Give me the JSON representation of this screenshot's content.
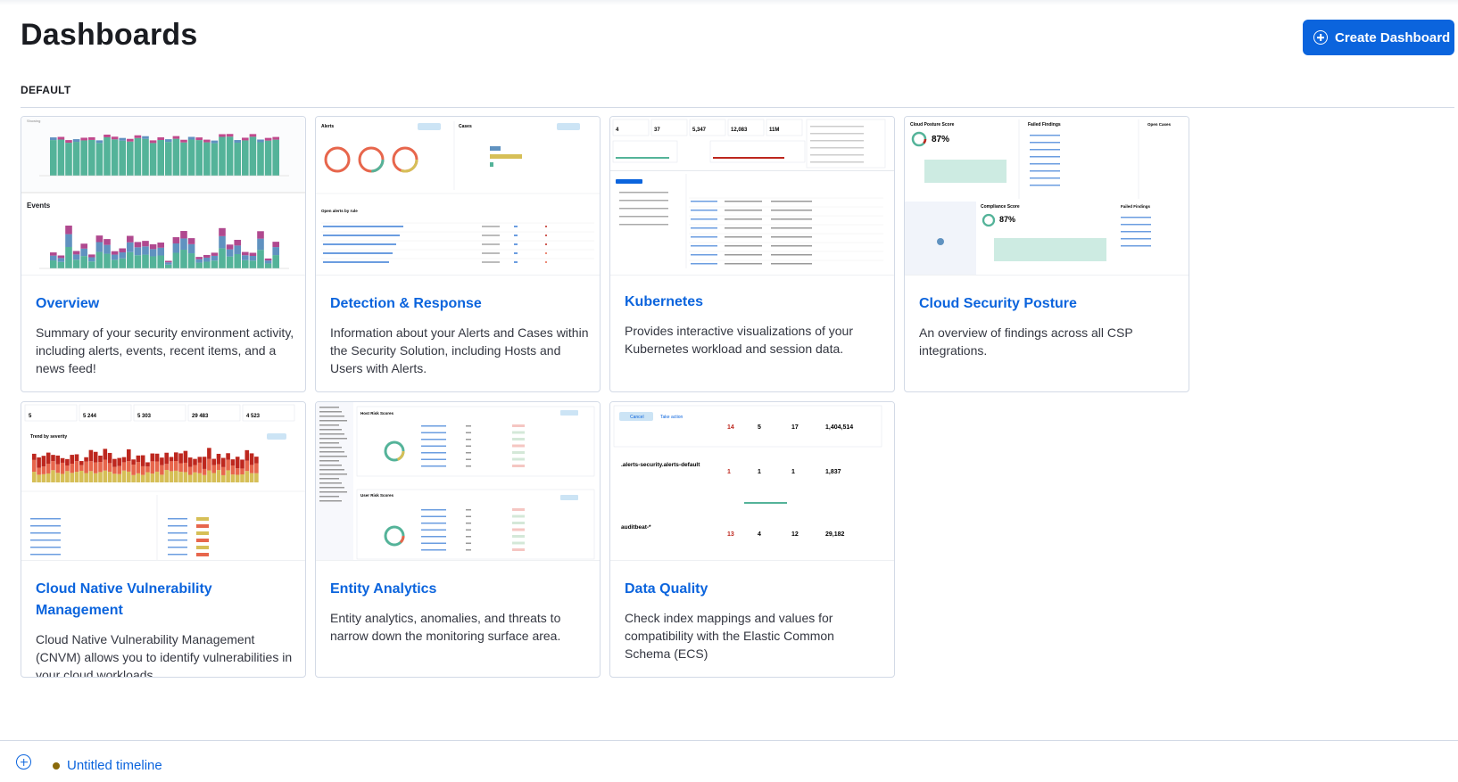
{
  "page": {
    "title": "Dashboards",
    "create_button_label": "Create Dashboard",
    "section_label": "DEFAULT"
  },
  "cards": [
    {
      "title": "Overview",
      "description": "Summary of your security environment activity, including alerts, events, recent items, and a news feed!"
    },
    {
      "title": "Detection & Response",
      "description": "Information about your Alerts and Cases within the Security Solution, including Hosts and Users with Alerts."
    },
    {
      "title": "Kubernetes",
      "description": "Provides interactive visualizations of your Kubernetes workload and session data."
    },
    {
      "title": "Cloud Security Posture",
      "description": "An overview of findings across all CSP integrations."
    },
    {
      "title": "Cloud Native Vulnerability Management",
      "description": "Cloud Native Vulnerability Management (CNVM) allows you to identify vulnerabilities in your cloud workloads."
    },
    {
      "title": "Entity Analytics",
      "description": "Entity analytics, anomalies, and threats to narrow down the monitoring surface area."
    },
    {
      "title": "Data Quality",
      "description": "Check index mappings and values for compatibility with the Elastic Common Schema (ECS)"
    }
  ],
  "thumbnails": {
    "overview": {
      "events_label": "Events"
    },
    "detection": {
      "alerts_label": "Alerts",
      "cases_label": "Cases",
      "open_alerts_label": "Open alerts by rule"
    },
    "k8s": {
      "stats": [
        "4",
        "37",
        "5,347",
        "12,083",
        "11M"
      ]
    },
    "csp": {
      "posture_label": "Cloud Posture Score",
      "posture_value": "87%",
      "failed_label": "Failed Findings",
      "open_cases_label": "Open Cases",
      "compliance_label": "Compliance Score",
      "compliance_value": "87%"
    },
    "cnvm": {
      "stats": [
        "5",
        "5 244",
        "5 303",
        "29 483",
        "4 523"
      ],
      "trend_label": "Trend by severity"
    },
    "entity": {
      "host_label": "Host Risk Scores",
      "user_label": "User Risk Scores"
    },
    "dq": {
      "cancel_label": "Cancel",
      "take_action_label": "Take action",
      "rows": [
        {
          "name": "",
          "incompatible": "14",
          "checked": "5",
          "indices": "17",
          "docs": "1,404,514"
        },
        {
          "name": ".alerts-security.alerts-default",
          "incompatible": "1",
          "checked": "1",
          "indices": "1",
          "docs": "1,837"
        },
        {
          "name": "auditbeat-*",
          "incompatible": "13",
          "checked": "4",
          "indices": "12",
          "docs": "29,182"
        }
      ]
    }
  },
  "bottom_bar": {
    "timeline_label": "Untitled timeline"
  },
  "colors": {
    "accent": "#0b64dd",
    "bar_green": "#54b399",
    "bar_purple": "#6092c0",
    "critical": "#bd271e",
    "high": "#e7664c",
    "medium": "#d6bf57"
  }
}
